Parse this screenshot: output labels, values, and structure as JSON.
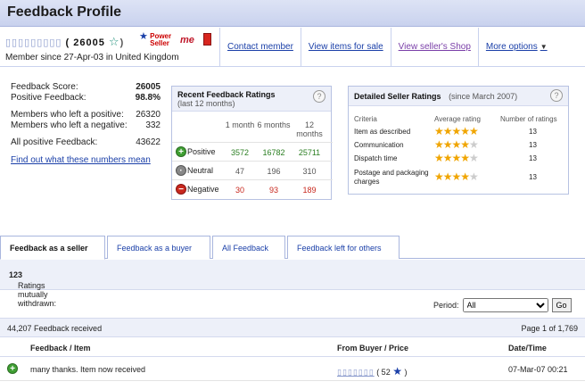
{
  "page": {
    "title": "Feedback Profile"
  },
  "member": {
    "username_masked": "▯▯▯▯▯▯▯▯▯",
    "score_text": "( 26005",
    "badge_close": ")",
    "power_seller_line1": "Power",
    "power_seller_line2": "Seller",
    "me_badge": "me",
    "member_since": "Member since 27-Apr-03 in United Kingdom"
  },
  "top_links": {
    "contact": "Contact member",
    "items": "View items for sale",
    "shop": "View seller's Shop",
    "more": "More options"
  },
  "summary": {
    "feedback_score_label": "Feedback Score:",
    "feedback_score_value": "26005",
    "positive_label": "Positive Feedback:",
    "positive_value": "98.8%",
    "left_positive_label": "Members who left a positive:",
    "left_positive_value": "26320",
    "left_negative_label": "Members who left a negative:",
    "left_negative_value": "332",
    "all_positive_label": "All positive Feedback:",
    "all_positive_value": "43622",
    "link": "Find out what these numbers mean"
  },
  "recent": {
    "title": "Recent Feedback Ratings",
    "subtitle": "(last 12 months)",
    "col_1": "1 month",
    "col_6": "6 months",
    "col_12a": "12",
    "col_12b": "months",
    "positive": {
      "label": "Positive",
      "m1": "3572",
      "m6": "16782",
      "m12": "25711"
    },
    "neutral": {
      "label": "Neutral",
      "m1": "47",
      "m6": "196",
      "m12": "310"
    },
    "negative": {
      "label": "Negative",
      "m1": "30",
      "m6": "93",
      "m12": "189"
    }
  },
  "dsr": {
    "title": "Detailed Seller Ratings",
    "subtitle": "(since March 2007)",
    "col_criteria": "Criteria",
    "col_avg": "Average rating",
    "col_num": "Number of ratings",
    "rows": [
      {
        "criteria": "Item as described",
        "stars": 5,
        "count": "13"
      },
      {
        "criteria": "Communication",
        "stars": 4.5,
        "count": "13"
      },
      {
        "criteria": "Dispatch time",
        "stars": 4.5,
        "count": "13"
      },
      {
        "criteria": "Postage and packaging charges",
        "stars": 4,
        "count": "13"
      }
    ]
  },
  "tabs": {
    "seller": "Feedback as a seller",
    "buyer": "Feedback as a buyer",
    "all": "All Feedback",
    "left": "Feedback left for others"
  },
  "withdrawn": {
    "label": "Ratings mutually withdrawn:",
    "value": "123"
  },
  "period": {
    "label": "Period:",
    "selected": "All",
    "go": "Go"
  },
  "list": {
    "received": "44,207 Feedback received",
    "page": "Page 1 of 1,769",
    "col_feedback": "Feedback / Item",
    "col_from": "From Buyer / Price",
    "col_date": "Date/Time",
    "rows": [
      {
        "text": "many thanks. Item now received",
        "buyer_masked": "▯▯▯▯▯▯▯",
        "buyer_score": "( 52",
        "close": ")",
        "date": "07-Mar-07 00:21"
      }
    ]
  }
}
